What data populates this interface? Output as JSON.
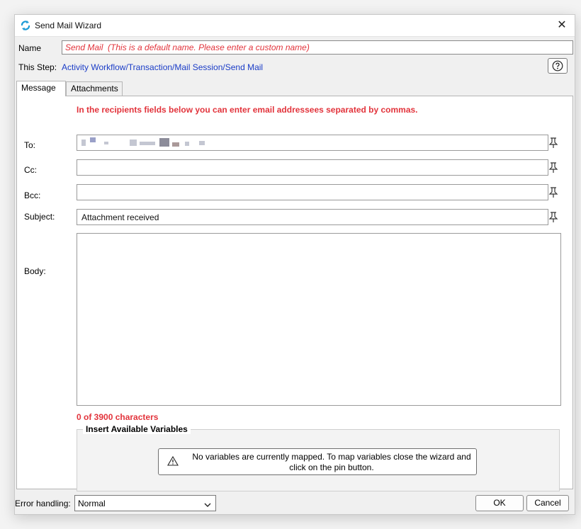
{
  "window": {
    "title": "Send Mail Wizard"
  },
  "name_row": {
    "label": "Name",
    "value": "Send Mail  (This is a default name. Please enter a custom name)"
  },
  "step_row": {
    "label": "This Step:",
    "value": "Activity Workflow/Transaction/Mail Session/Send Mail"
  },
  "tabs": [
    {
      "label": "Message",
      "active": true
    },
    {
      "label": "Attachments",
      "active": false
    }
  ],
  "message": {
    "info": "In the recipients fields below you can enter email addressees separated by commas.",
    "to": {
      "label": "To:",
      "value": ""
    },
    "cc": {
      "label": "Cc:",
      "value": ""
    },
    "bcc": {
      "label": "Bcc:",
      "value": ""
    },
    "subject": {
      "label": "Subject:",
      "value": "Attachment received"
    },
    "body": {
      "label": "Body:",
      "value": ""
    },
    "char_count": "0 of 3900 characters"
  },
  "variables": {
    "legend": "Insert Available Variables",
    "message": "No variables are currently mapped. To map variables close the wizard and click on the pin button."
  },
  "footer": {
    "error_label": "Error handling:",
    "error_value": "Normal",
    "ok": "OK",
    "cancel": "Cancel"
  },
  "colors": {
    "warning_red": "#e2333b",
    "link_blue": "#1a3cc7"
  },
  "icons": [
    "app-icon",
    "close-icon",
    "help-icon",
    "pin-icon",
    "warning-icon",
    "chevron-down-icon"
  ]
}
